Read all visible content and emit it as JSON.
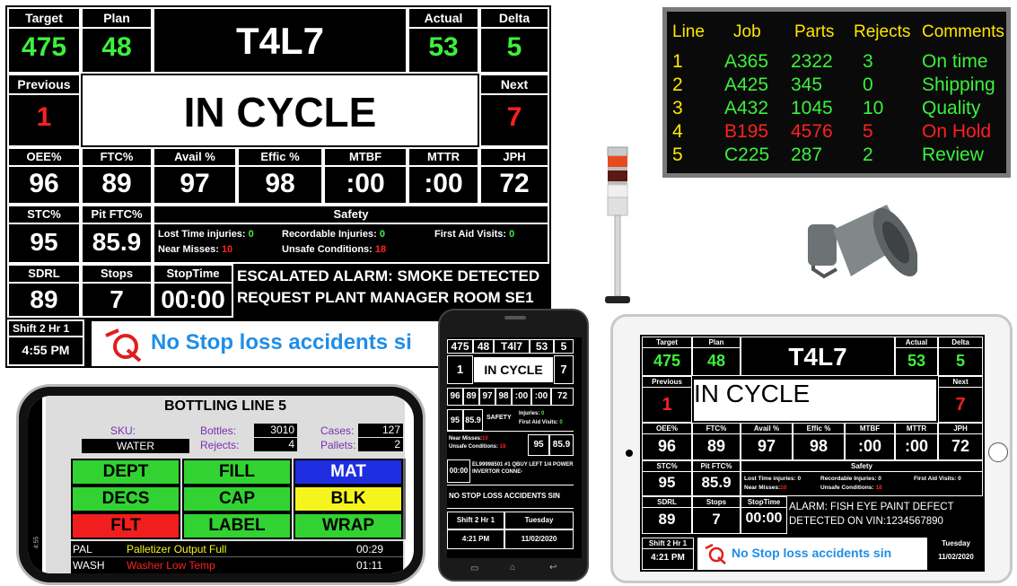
{
  "board": {
    "target_label": "Target",
    "target_value": "475",
    "plan_label": "Plan",
    "plan_value": "48",
    "line_code": "T4L7",
    "actual_label": "Actual",
    "actual_value": "53",
    "delta_label": "Delta",
    "delta_value": "5",
    "previous_label": "Previous",
    "previous_value": "1",
    "status": "IN CYCLE",
    "next_label": "Next",
    "next_value": "7",
    "metrics": [
      {
        "label": "OEE%",
        "value": "96"
      },
      {
        "label": "FTC%",
        "value": "89"
      },
      {
        "label": "Avail %",
        "value": "97"
      },
      {
        "label": "Effic %",
        "value": "98"
      },
      {
        "label": "MTBF",
        "value": ":00"
      },
      {
        "label": "MTTR",
        "value": ":00"
      },
      {
        "label": "JPH",
        "value": "72"
      }
    ],
    "stc_label": "STC%",
    "stc_value": "95",
    "pitftc_label": "Pit FTC%",
    "pitftc_value": "85.9",
    "safety_label": "Safety",
    "safety": {
      "lost_time_label": "Lost Time injuries:",
      "lost_time_value": "0",
      "recordable_label": "Recordable Injuries:",
      "recordable_value": "0",
      "first_aid_label": "First Aid Visits:",
      "first_aid_value": "0",
      "near_misses_label": "Near Misses:",
      "near_misses_value": "10",
      "unsafe_label": "Unsafe Conditions:",
      "unsafe_value": "18"
    },
    "sdrl_label": "SDRL",
    "sdrl_value": "89",
    "stops_label": "Stops",
    "stops_value": "7",
    "stoptime_label": "StopTime",
    "stoptime_value": "00:00",
    "alarm_line1": "ESCALATED ALARM: SMOKE DETECTED",
    "alarm_line2": "REQUEST  PLANT MANAGER ROOM SE1",
    "shift_label": "Shift 2  Hr 1",
    "shift_time": "4:55  PM",
    "ticker": "No Stop loss accidents si"
  },
  "jobs_table": {
    "headers": [
      "Line",
      "Job",
      "Parts",
      "Rejects",
      "Comments"
    ],
    "rows": [
      {
        "line": "1",
        "job": "A365",
        "parts": "2322",
        "rejects": "3",
        "comment": "On time",
        "status": "ok"
      },
      {
        "line": "2",
        "job": "A425",
        "parts": "345",
        "rejects": "0",
        "comment": "Shipping",
        "status": "ok"
      },
      {
        "line": "3",
        "job": "A432",
        "parts": "1045",
        "rejects": "10",
        "comment": "Quality",
        "status": "ok"
      },
      {
        "line": "4",
        "job": "B195",
        "parts": "4576",
        "rejects": "5",
        "comment": "On Hold",
        "status": "bad"
      },
      {
        "line": "5",
        "job": "C225",
        "parts": "287",
        "rejects": "2",
        "comment": "Review",
        "status": "ok"
      }
    ]
  },
  "bottling": {
    "title": "BOTTLING LINE 5",
    "sku_label": "SKU:",
    "sku_value": "WATER",
    "bottles_label": "Bottles:",
    "bottles_value": "3010",
    "rejects_label": "Rejects:",
    "rejects_value": "4",
    "cases_label": "Cases:",
    "cases_value": "127",
    "pallets_label": "Pallets:",
    "pallets_value": "2",
    "buttons": [
      {
        "label": "DEPT",
        "color": "#32d232"
      },
      {
        "label": "FILL",
        "color": "#32d232"
      },
      {
        "label": "MAT",
        "color": "#1f2ee0"
      },
      {
        "label": "DECS",
        "color": "#32d232"
      },
      {
        "label": "CAP",
        "color": "#32d232"
      },
      {
        "label": "BLK",
        "color": "#f5f51e"
      },
      {
        "label": "FLT",
        "color": "#f01e1e"
      },
      {
        "label": "LABEL",
        "color": "#32d232"
      },
      {
        "label": "WRAP",
        "color": "#32d232"
      }
    ],
    "alarms": [
      {
        "code": "PAL",
        "message": "Palletizer Output Full",
        "time": "00:29",
        "color": "#f5f51e"
      },
      {
        "code": "WASH",
        "message": "Washer  Low Temp",
        "time": "01:11",
        "color": "#ff2020"
      }
    ],
    "side_time": "4:55"
  },
  "phone": {
    "values": [
      "475",
      "48",
      "T4l7",
      "53",
      "5"
    ],
    "previous": "1",
    "status": "IN CYCLE",
    "next": "7",
    "metrics": [
      "96",
      "89",
      "97",
      "98",
      ":00",
      ":00",
      "72"
    ],
    "stc": "95",
    "pitftc": "85.9",
    "safety": "SAFETY",
    "injuries_label": "Injuries:",
    "injuries_value": "0",
    "first_aid_label": "First Aid Visits:",
    "first_aid_value": "0",
    "near_misses_label": "Near Misses:",
    "near_misses_value": "10",
    "unsafe_label": "Unsafe Conditions:",
    "unsafe_value": "18",
    "sdrl": "95",
    "pit2": "85.9",
    "stoptime": "00:00",
    "alarm": "EL99998501 #1 QBUY LEFT 1/4 POWER INVERTOR CONNE-",
    "ticker": "NO STOP LOSS ACCIDENTS SIN",
    "shift": "Shift 2 Hr 1",
    "day": "Tuesday",
    "time": "4:21 PM",
    "date": "11/02/2020"
  },
  "tablet": {
    "target_label": "Target",
    "target_value": "475",
    "plan_label": "Plan",
    "plan_value": "48",
    "line_code": "T4L7",
    "actual_label": "Actual",
    "actual_value": "53",
    "delta_label": "Delta",
    "delta_value": "5",
    "previous_label": "Previous",
    "previous_value": "1",
    "status": "IN CYCLE",
    "next_label": "Next",
    "next_value": "7",
    "metrics": [
      {
        "label": "OEE%",
        "value": "96"
      },
      {
        "label": "FTC%",
        "value": "89"
      },
      {
        "label": "Avail %",
        "value": "97"
      },
      {
        "label": "Effic %",
        "value": "98"
      },
      {
        "label": "MTBF",
        "value": ":00"
      },
      {
        "label": "MTTR",
        "value": ":00"
      },
      {
        "label": "JPH",
        "value": "72"
      }
    ],
    "stc_label": "STC%",
    "stc_value": "95",
    "pitftc_label": "Pit FTC%",
    "pitftc_value": "85.9",
    "safety_label": "Safety",
    "lost_time": "Lost Time injuries: 0",
    "recordable": "Recordable Injuries: 0",
    "first_aid": "First Aid Visits: 0",
    "near_misses": "Near Misses:",
    "near_misses_value": "10",
    "unsafe": "Unsafe Conditions:",
    "unsafe_value": "18",
    "sdrl_label": "SDRL",
    "sdrl_value": "89",
    "stops_label": "Stops",
    "stops_value": "7",
    "stoptime_label": "StopTime",
    "stoptime_value": "00:00",
    "alarm_line1": "ALARM: FISH EYE PAINT DEFECT",
    "alarm_line2": "DETECTED ON VIN:1234567890",
    "shift_label": "Shift 2  Hr 1",
    "time": "4:21 PM",
    "ticker": "No Stop loss accidents sin",
    "day": "Tuesday",
    "date": "11/02/2020"
  }
}
